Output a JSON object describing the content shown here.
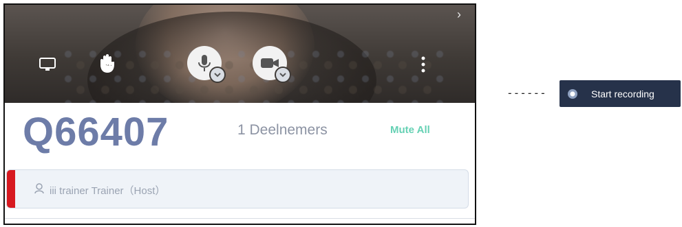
{
  "meeting": {
    "room_id": "Q66407",
    "participants_label": "1 Deelnemers",
    "mute_all_label": "Mute All"
  },
  "controls": {
    "icons": [
      "screen-share-icon",
      "raise-hand-icon",
      "microphone-icon",
      "camera-icon",
      "more-options-icon",
      "chevron-right-icon"
    ]
  },
  "participant": {
    "name": "iii trainer Trainer（Host）"
  },
  "callout": {
    "connector": "------",
    "record_label": "Start recording"
  },
  "colors": {
    "room_id": "#6d7ca8",
    "mute_all": "#66d1b4",
    "host_accent": "#d71920",
    "record_button": "#26324a"
  }
}
